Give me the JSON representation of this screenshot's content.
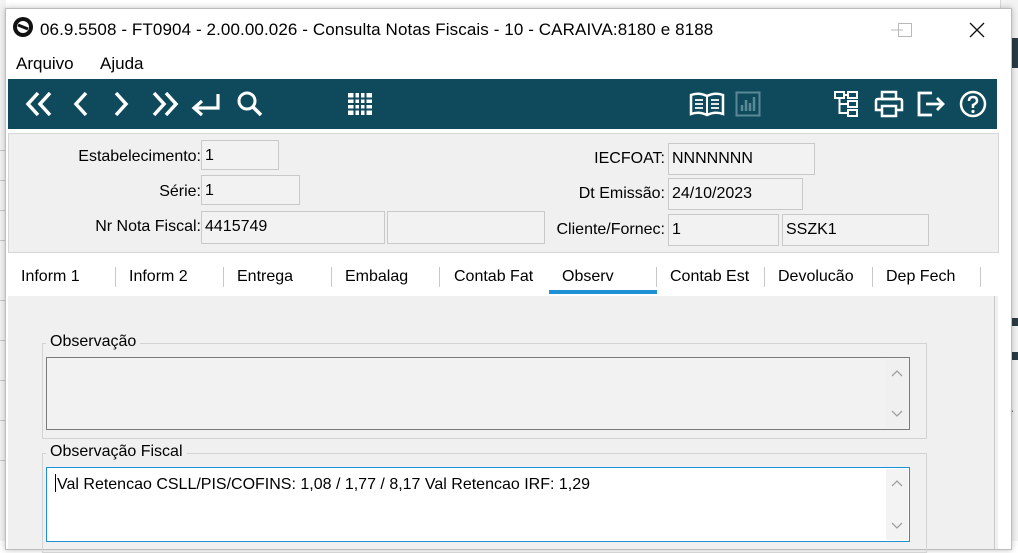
{
  "window": {
    "title": "06.9.5508 - FT0904 - 2.00.00.026 - Consulta Notas Fiscais - 10 - CARAIVA:8180 e 8188"
  },
  "menu": {
    "items": [
      "Arquivo",
      "Ajuda"
    ]
  },
  "toolbar": {
    "left_icons": [
      "first-record-icon",
      "previous-record-icon",
      "next-record-icon",
      "last-record-icon",
      "goto-icon",
      "search-icon",
      "grid-icon"
    ],
    "right_icons": [
      "book-icon",
      "chart-icon",
      "tree-icon",
      "print-icon",
      "exit-icon",
      "help-icon"
    ]
  },
  "header": {
    "estabelecimento_label": "Estabelecimento:",
    "estabelecimento_value": "1",
    "serie_label": "Série:",
    "serie_value": "1",
    "nr_nota_label": "Nr Nota Fiscal:",
    "nr_nota_value": "4415749",
    "nr_nota_extra": "",
    "iecfoat_label": "IECFOAT:",
    "iecfoat_value": "NNNNNNN",
    "dt_emissao_label": "Dt Emissão:",
    "dt_emissao_value": "24/10/2023",
    "cliente_label": "Cliente/Fornec:",
    "cliente_code": "1",
    "cliente_name": "SSZK1"
  },
  "tabs": [
    "Inform 1",
    "Inform 2",
    "Entrega",
    "Embalag",
    "Contab Fat",
    "Observ",
    "Contab Est",
    "Devolucão",
    "Dep Fech"
  ],
  "active_tab": "Observ",
  "observ": {
    "observacao_title": "Observação",
    "observacao_text": "",
    "fiscal_title": "Observação Fiscal",
    "fiscal_text": "Val Retencao CSLL/PIS/COFINS: 1,08 / 1,77 / 8,17 Val Retencao IRF: 1,29"
  },
  "colors": {
    "toolbar_bg": "#0e4a5c",
    "tab_active": "#1e90d6",
    "panel_bg": "#f0f0f0"
  }
}
